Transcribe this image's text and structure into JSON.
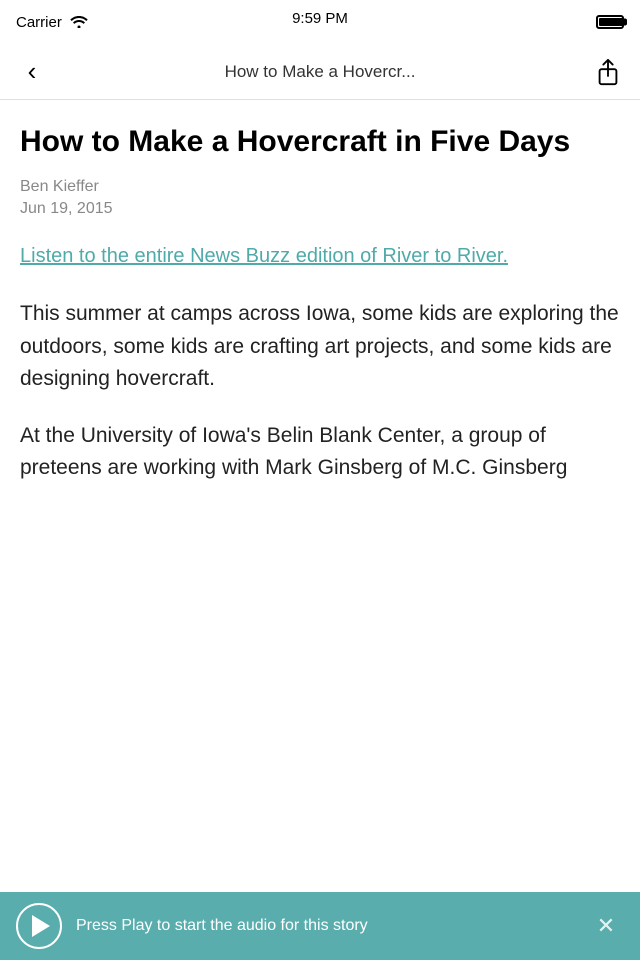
{
  "status_bar": {
    "carrier": "Carrier",
    "time": "9:59 PM"
  },
  "nav": {
    "title": "How to Make a Hovercr...",
    "back_label": "‹",
    "share_label": "Share"
  },
  "article": {
    "title": "How to Make a Hovercraft in Five Days",
    "author": "Ben Kieffer",
    "date": "Jun 19, 2015",
    "link_text": "Listen to the entire News Buzz edition of River to River.",
    "body_paragraph_1": "This summer at camps across Iowa, some kids are exploring the outdoors, some kids are crafting art projects, and some kids are designing hovercraft.",
    "body_paragraph_2": "At the University of Iowa's Belin Blank Center, a group of preteens are working with Mark Ginsberg of M.C. Ginsberg"
  },
  "audio_player": {
    "prompt": "Press Play to start the audio for this story"
  },
  "colors": {
    "link": "#4faaaa",
    "audio_bar": "#5aadad"
  }
}
